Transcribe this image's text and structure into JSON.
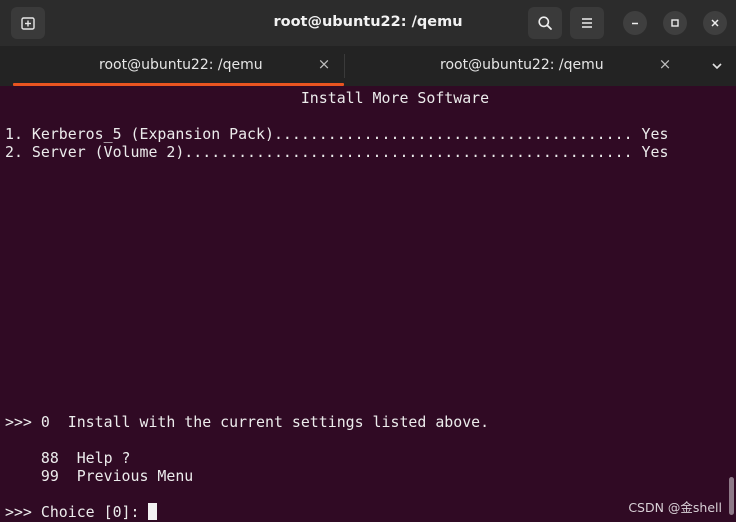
{
  "window": {
    "title": "root@ubuntu22: /qemu"
  },
  "titlebar": {
    "new_tab_icon": "new-tab-icon",
    "search_icon": "search-icon",
    "menu_icon": "hamburger-menu-icon",
    "minimize_icon": "minimize-icon",
    "maximize_icon": "maximize-icon",
    "close_icon": "close-icon"
  },
  "tabs": [
    {
      "label": "root@ubuntu22: /qemu",
      "active": true,
      "close": "×"
    },
    {
      "label": "root@ubuntu22: /qemu",
      "active": false,
      "close": "×"
    }
  ],
  "colors": {
    "terminal_bg": "#300a24",
    "accent": "#e95420",
    "titlebar_bg": "#2c2c2c",
    "tabbar_bg": "#232323"
  },
  "terminal": {
    "lines": [
      "                                 Install More Software",
      "",
      "1. Kerberos_5 (Expansion Pack)........................................ Yes",
      "2. Server (Volume 2).................................................. Yes",
      "",
      "",
      "",
      "",
      "",
      "",
      "",
      "",
      "",
      "",
      "",
      "",
      ">>> 0  Install with the current settings listed above.",
      "",
      "    88  Help ?",
      "    99  Previous Menu",
      "",
      ">>> Choice [0]: "
    ]
  },
  "watermark": "CSDN @金shell"
}
